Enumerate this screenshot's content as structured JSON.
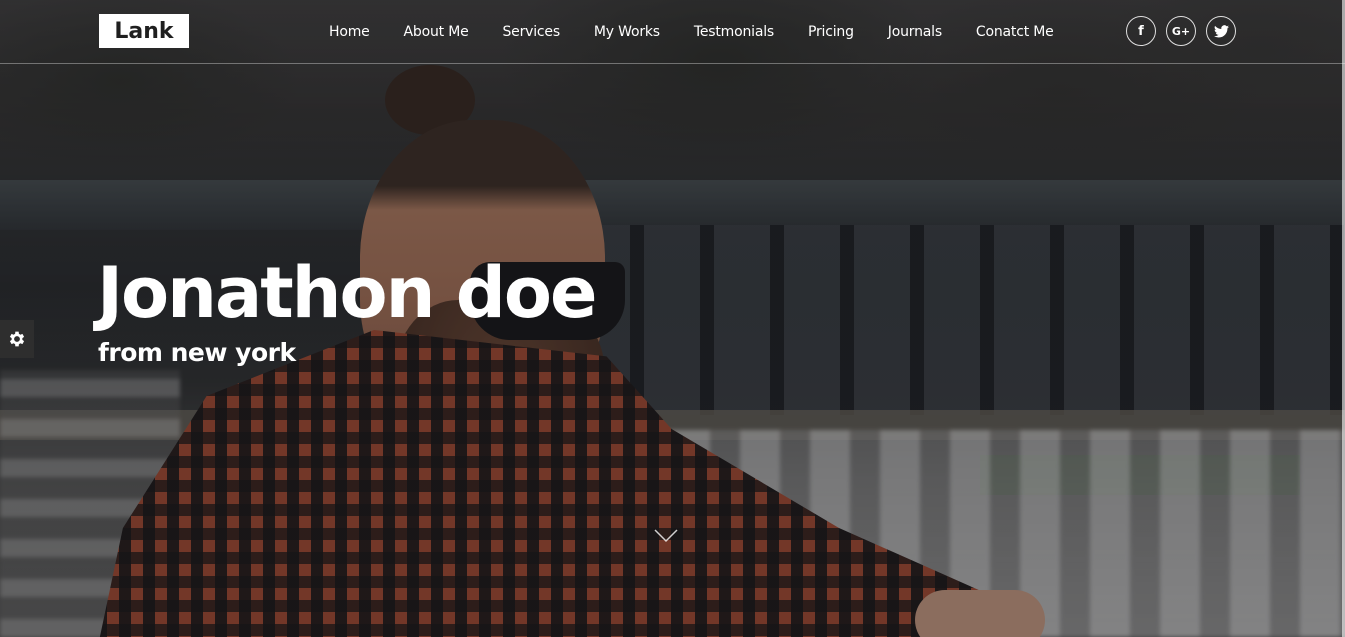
{
  "header": {
    "logo": "Lank",
    "nav": [
      "Home",
      "About Me",
      "Services",
      "My Works",
      "Testmonials",
      "Pricing",
      "Journals",
      "Conatct Me"
    ],
    "social": [
      {
        "icon": "facebook-icon",
        "glyph": "f"
      },
      {
        "icon": "google-plus-icon",
        "glyph": "G+"
      },
      {
        "icon": "twitter-icon",
        "glyph": ""
      }
    ]
  },
  "hero": {
    "title": "Jonathon doe",
    "subtitle": "from new york"
  },
  "colors": {
    "logo_bg": "#ffffff",
    "logo_text": "#1f1f1f",
    "text": "#ffffff",
    "settings_bg": "#2e2e2e"
  },
  "icons": {
    "settings": "gear-icon",
    "scroll": "chevron-down-icon"
  }
}
